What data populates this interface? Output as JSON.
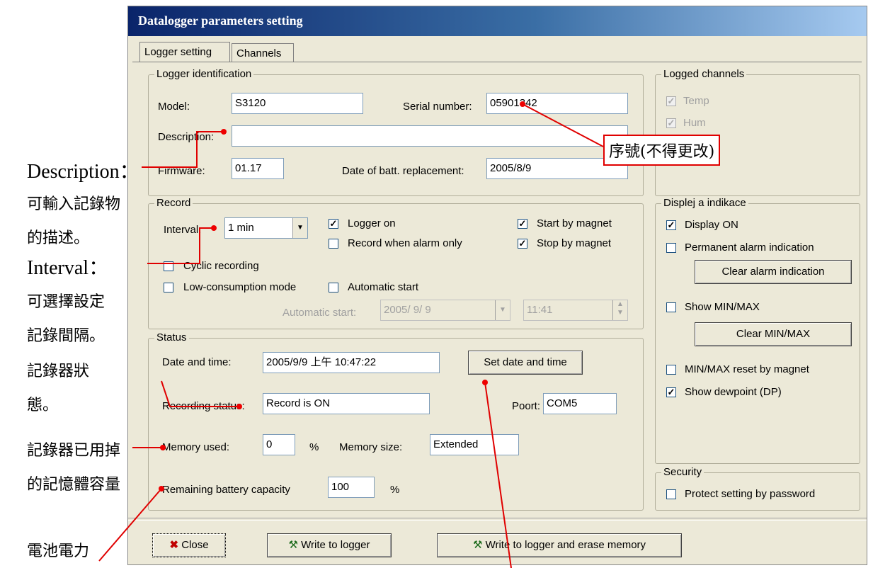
{
  "window": {
    "title": "Datalogger parameters setting"
  },
  "tabs": [
    {
      "label": "Logger setting"
    },
    {
      "label": "Channels"
    }
  ],
  "identification": {
    "legend": "Logger identification",
    "model_label": "Model:",
    "model_value": "S3120",
    "serial_label": "Serial number:",
    "serial_value": "05901342",
    "description_label": "Description:",
    "description_value": "",
    "firmware_label": "Firmware:",
    "firmware_value": "01.17",
    "batt_label": "Date of batt. replacement:",
    "batt_value": "2005/8/9"
  },
  "logged_channels": {
    "legend": "Logged channels",
    "items": [
      {
        "label": "Temp",
        "checked": true
      },
      {
        "label": "Hum",
        "checked": true
      }
    ]
  },
  "record": {
    "legend": "Record",
    "interval_label": "Interval:",
    "interval_value": "1 min",
    "logger_on": "Logger on",
    "record_when_alarm": "Record when alarm only",
    "start_by_magnet": "Start by magnet",
    "stop_by_magnet": "Stop by magnet",
    "cyclic": "Cyclic recording",
    "low_consumption": "Low-consumption mode",
    "automatic_start": "Automatic start",
    "auto_start_label": "Automatic start:",
    "auto_date": "2005/ 9/ 9",
    "auto_time": "11:41"
  },
  "status": {
    "legend": "Status",
    "datetime_label": "Date and time:",
    "datetime_value": "2005/9/9 上午 10:47:22",
    "set_button": "Set date and time",
    "recording_label": "Recording status:",
    "recording_value": "Record is ON",
    "port_label": "Poort:",
    "port_value": "COM5",
    "memory_label": "Memory used:",
    "memory_value": "0",
    "memory_unit": "%",
    "memsize_label": "Memory size:",
    "memsize_value": "Extended",
    "battery_label": "Remaining battery capacity",
    "battery_value": "100",
    "battery_unit": "%"
  },
  "display": {
    "legend": "Displej a indikace",
    "display_on": "Display ON",
    "permanent_alarm": "Permanent alarm indication",
    "clear_alarm": "Clear alarm indication",
    "show_minmax": "Show MIN/MAX",
    "clear_minmax": "Clear MIN/MAX",
    "minmax_reset": "MIN/MAX reset by magnet",
    "show_dewpoint": "Show dewpoint (DP)"
  },
  "security": {
    "legend": "Security",
    "protect": "Protect setting by password"
  },
  "footer": {
    "close": "Close",
    "write": "Write to logger",
    "write_erase": "Write to logger and erase memory"
  },
  "annotations": {
    "serial_note": "序號(不得更改)",
    "desc_title": "Description：",
    "desc_line1": "可輸入記錄物",
    "desc_line2": "的描述。",
    "interval_title": "Interval：",
    "interval_line1": "可選擇設定",
    "interval_line2": "記錄間隔。",
    "status_line1": "記錄器狀",
    "status_line2": "態。",
    "memory_line1": "記錄器已用掉",
    "memory_line2": "的記憶體容量",
    "battery_note": "電池電力"
  },
  "colors": {
    "annotation_line": "#e00000",
    "titlebar": "#0a246a"
  }
}
